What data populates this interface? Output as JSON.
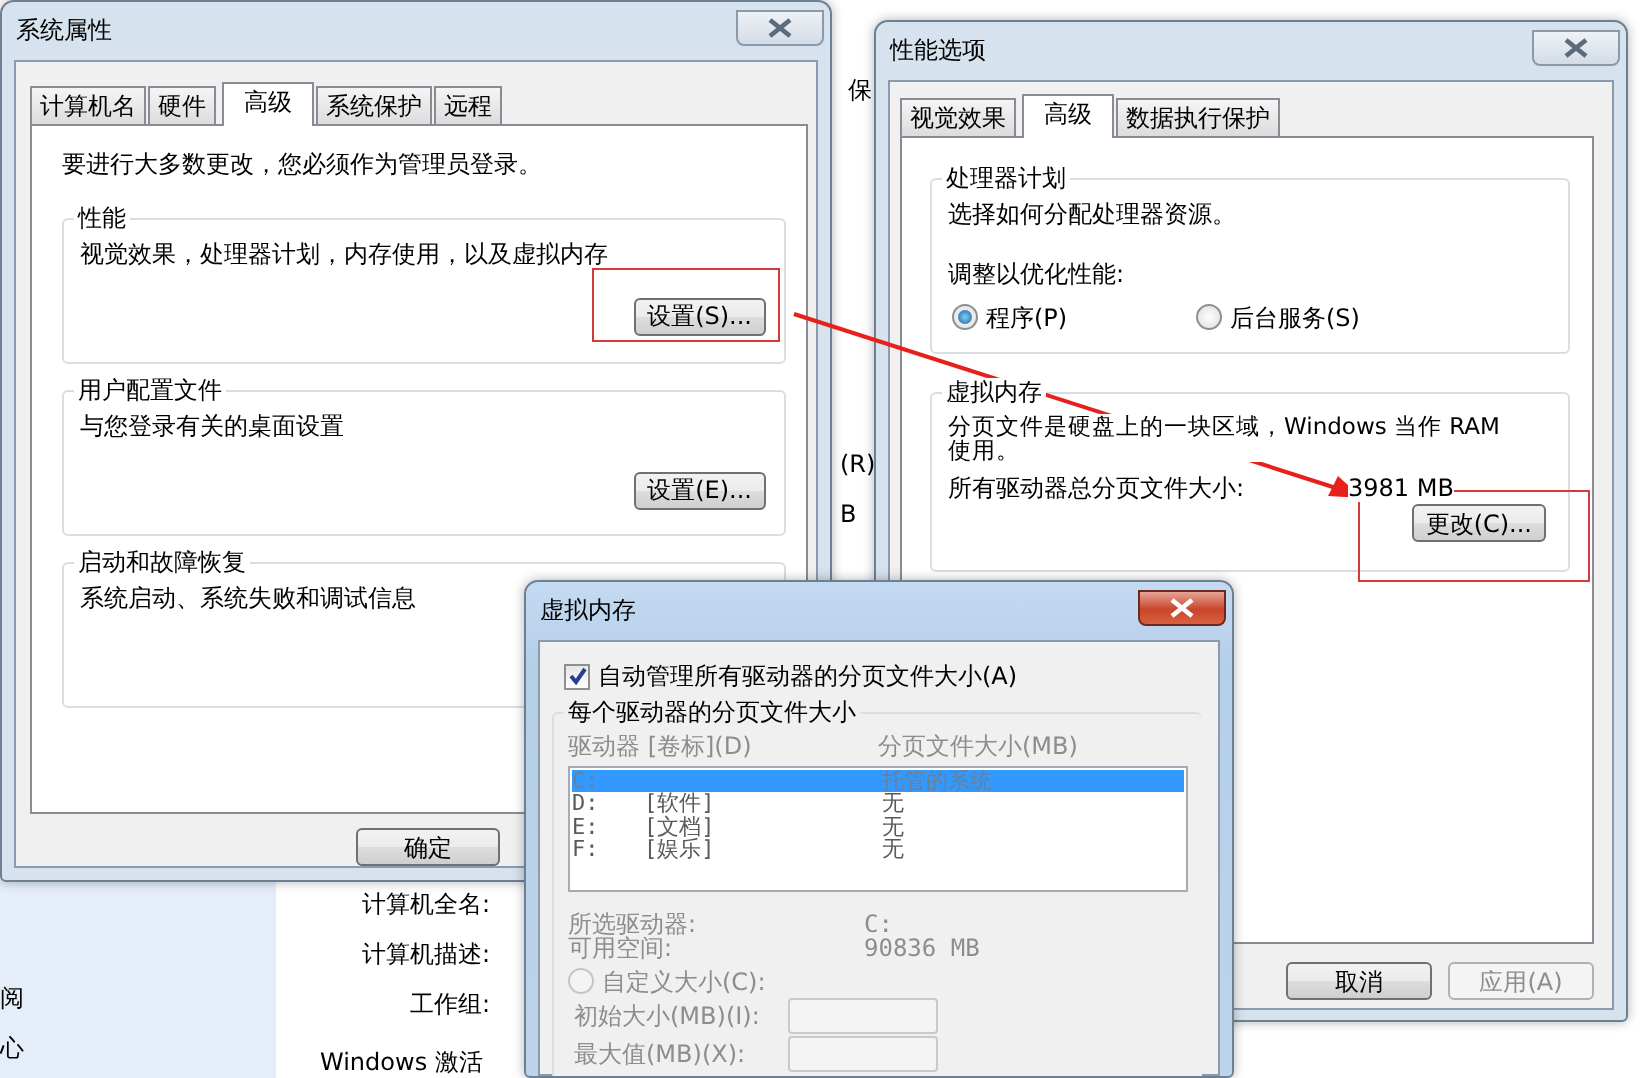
{
  "background": {
    "sidebar_items": [
      {
        "label": "阅"
      },
      {
        "label": "心"
      }
    ],
    "fragments": [
      "保",
      "(R)",
      "B"
    ],
    "fields": [
      {
        "label": "计算机全名:"
      },
      {
        "label": "计算机描述:"
      },
      {
        "label": "工作组:"
      }
    ],
    "section_title": "Windows 激活"
  },
  "system_properties": {
    "title": "系统属性",
    "active": false,
    "tabs": [
      {
        "label": "计算机名",
        "selected": false
      },
      {
        "label": "硬件",
        "selected": false
      },
      {
        "label": "高级",
        "selected": true
      },
      {
        "label": "系统保护",
        "selected": false
      },
      {
        "label": "远程",
        "selected": false
      }
    ],
    "notice": "要进行大多数更改，您必须作为管理员登录。",
    "groups": [
      {
        "title": "性能",
        "description": "视觉效果，处理器计划，内存使用，以及虚拟内存",
        "button": "设置(S)...",
        "highlighted": true
      },
      {
        "title": "用户配置文件",
        "description": "与您登录有关的桌面设置",
        "button": "设置(E)...",
        "highlighted": false
      },
      {
        "title": "启动和故障恢复",
        "description": "系统启动、系统失败和调试信息",
        "highlighted": false
      }
    ],
    "buttons": [
      {
        "label": "确定",
        "disabled": false
      }
    ]
  },
  "performance_options": {
    "title": "性能选项",
    "active": false,
    "tabs": [
      {
        "label": "视觉效果",
        "selected": false
      },
      {
        "label": "高级",
        "selected": true
      },
      {
        "label": "数据执行保护",
        "selected": false
      }
    ],
    "processor": {
      "title": "处理器计划",
      "description": "选择如何分配处理器资源。",
      "prompt": "调整以优化性能:",
      "options": [
        {
          "label": "程序(P)",
          "selected": true
        },
        {
          "label": "后台服务(S)",
          "selected": false
        }
      ]
    },
    "virtual_memory": {
      "title": "虚拟内存",
      "description": "分页文件是硬盘上的一块区域，Windows 当作 RAM 使用。",
      "total_label": "所有驱动器总分页文件大小:",
      "total_value": "3981 MB",
      "button": "更改(C)...",
      "highlighted": true
    },
    "buttons": [
      {
        "label": "取消",
        "disabled": false
      },
      {
        "label": "应用(A)",
        "disabled": true
      }
    ]
  },
  "virtual_memory_dialog": {
    "title": "虚拟内存",
    "active": true,
    "auto_manage": {
      "label": "自动管理所有驱动器的分页文件大小(A)",
      "checked": true
    },
    "group_title": "每个驱动器的分页文件大小",
    "columns": [
      "驱动器 [卷标](D)",
      "分页文件大小(MB)"
    ],
    "drives": [
      {
        "drive": "C:",
        "size": "托管的系统",
        "selected": true
      },
      {
        "drive": "D:",
        "volume": "[软件]",
        "size": "无",
        "selected": false
      },
      {
        "drive": "E:",
        "volume": "[文档]",
        "size": "无",
        "selected": false
      },
      {
        "drive": "F:",
        "volume": "[娱乐]",
        "size": "无",
        "selected": false
      }
    ],
    "selected_drive": {
      "label": "所选驱动器:",
      "value": "C:"
    },
    "free_space": {
      "label": "可用空间:",
      "value": "90836 MB"
    },
    "custom_size": {
      "label": "自定义大小(C):",
      "selected": false
    },
    "initial_size": {
      "label": "初始大小(MB)(I):"
    },
    "max_size": {
      "label": "最大值(MB)(X):"
    },
    "disabled": true
  }
}
